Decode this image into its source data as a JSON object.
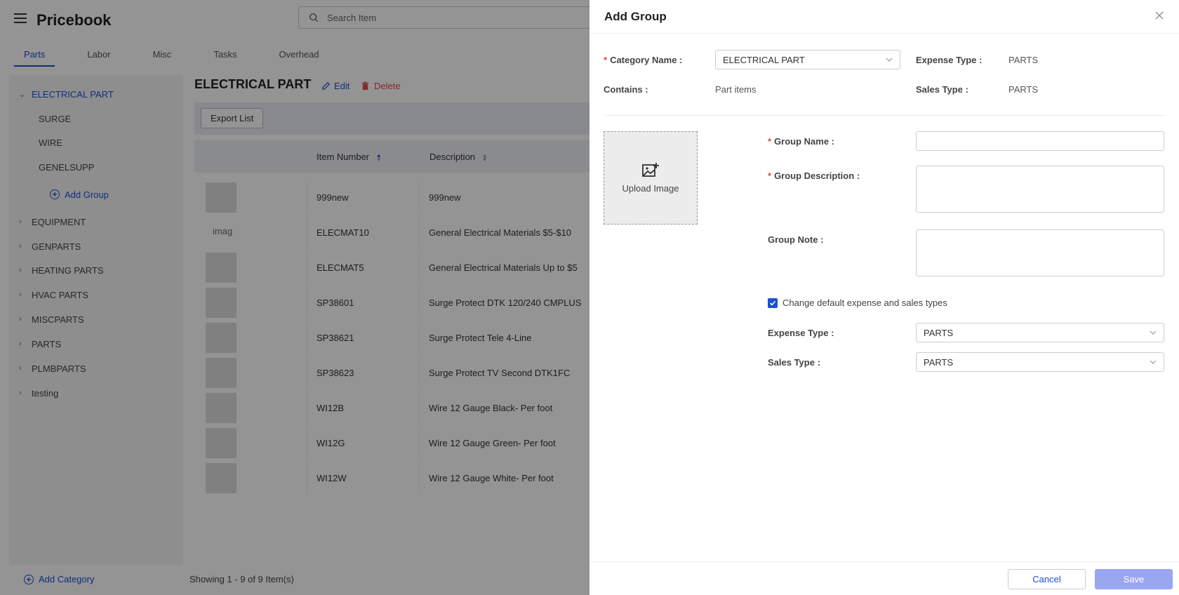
{
  "app": {
    "title": "Pricebook",
    "search_placeholder": "Search Item",
    "tabs": [
      {
        "label": "Parts"
      },
      {
        "label": "Labor"
      },
      {
        "label": "Misc"
      },
      {
        "label": "Tasks"
      },
      {
        "label": "Overhead"
      }
    ]
  },
  "sidebar": {
    "selected_category": "ELECTRICAL PART",
    "groups": [
      "SURGE",
      "WIRE",
      "GENELSUPP"
    ],
    "add_group_label": "Add Group",
    "categories": [
      "EQUIPMENT",
      "GENPARTS",
      "HEATING PARTS",
      "HVAC PARTS",
      "MISCPARTS",
      "PARTS",
      "PLMBPARTS",
      "testing"
    ],
    "add_category_label": "Add Category"
  },
  "main": {
    "title": "ELECTRICAL PART",
    "edit_label": "Edit",
    "delete_label": "Delete",
    "export_label": "Export List",
    "columns": {
      "item_number": "Item Number",
      "description": "Description"
    },
    "broken_image_alt": "imag",
    "rows": [
      {
        "item": "999new",
        "desc": "999new"
      },
      {
        "item": "ELECMAT10",
        "desc": "General Electrical Materials $5-$10"
      },
      {
        "item": "ELECMAT5",
        "desc": "General Electrical Materials Up to $5"
      },
      {
        "item": "SP38601",
        "desc": "Surge Protect DTK 120/240 CMPLUS"
      },
      {
        "item": "SP38621",
        "desc": "Surge Protect Tele 4-Line"
      },
      {
        "item": "SP38623",
        "desc": "Surge Protect TV Second DTK1FC"
      },
      {
        "item": "WI12B",
        "desc": "Wire 12 Gauge Black- Per foot"
      },
      {
        "item": "WI12G",
        "desc": "Wire 12 Gauge Green- Per foot"
      },
      {
        "item": "WI12W",
        "desc": "Wire 12 Gauge White- Per foot"
      }
    ],
    "status": "Showing 1 - 9 of 9 Item(s)"
  },
  "drawer": {
    "title": "Add Group",
    "category_name_label": "Category Name :",
    "category_name_value": "ELECTRICAL PART",
    "expense_type_label": "Expense Type :",
    "expense_type_value": "PARTS",
    "contains_label": "Contains :",
    "contains_value": "Part items",
    "sales_type_label": "Sales Type :",
    "sales_type_value": "PARTS",
    "upload_label": "Upload Image",
    "group_name_label": "Group Name :",
    "group_description_label": "Group Description :",
    "group_note_label": "Group Note :",
    "change_default_label": "Change default expense and sales types",
    "expense_type_select_label": "Expense Type :",
    "expense_type_select_value": "PARTS",
    "sales_type_select_label": "Sales Type :",
    "sales_type_select_value": "PARTS",
    "cancel_label": "Cancel",
    "save_label": "Save"
  },
  "colors": {
    "accent": "#1a4fd6",
    "danger": "#e04a4a",
    "save_disabled": "#9aa6f0"
  }
}
